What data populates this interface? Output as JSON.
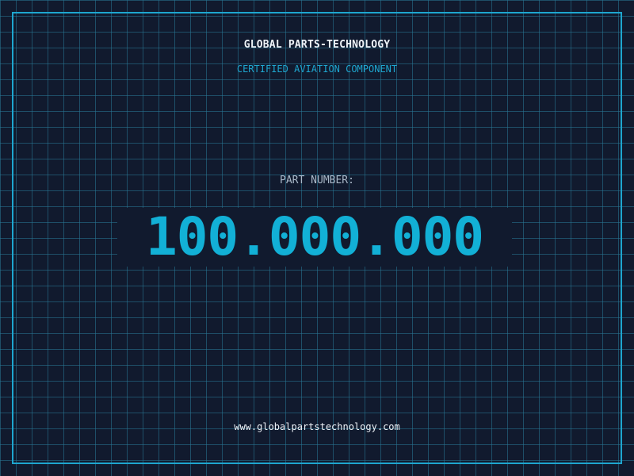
{
  "header": {
    "company": "GLOBAL PARTS-TECHNOLOGY",
    "tagline": "CERTIFIED AVIATION COMPONENT"
  },
  "part": {
    "label": "PART NUMBER:",
    "number": "100.000.000"
  },
  "footer": {
    "website": "www.globalpartstechnology.com"
  },
  "colors": {
    "background": "#111a2e",
    "grid": "#28789a",
    "accent": "#1ea6cf",
    "part_number": "#12b0d6",
    "text": "#eef3f8",
    "muted_text": "#a9b8c8"
  }
}
